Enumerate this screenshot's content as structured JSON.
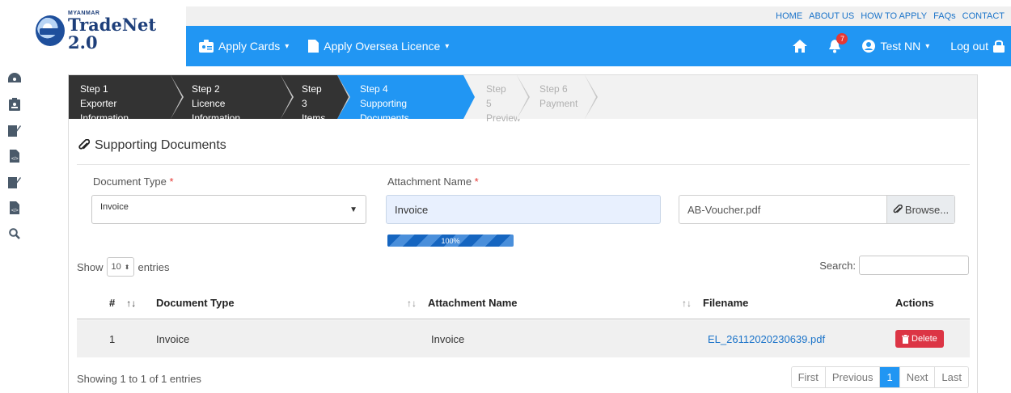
{
  "logo": {
    "small": "MYANMAR",
    "big": "TradeNet 2.0"
  },
  "toplinks": [
    "HOME",
    "ABOUT US",
    "HOW TO APPLY",
    "FAQs",
    "CONTACT"
  ],
  "nav": {
    "apply_cards": "Apply Cards",
    "apply_oversea": "Apply Oversea Licence",
    "notifications_count": "7",
    "user": "Test NN",
    "logout": "Log out"
  },
  "sidebar_icons": [
    "dashboard-icon",
    "id-card-icon",
    "signature-icon",
    "code-file-icon",
    "signature-icon",
    "code-file-icon",
    "search-icon"
  ],
  "steps": [
    {
      "num": "Step 1",
      "name": "Exporter Information",
      "state": "done"
    },
    {
      "num": "Step 2",
      "name": "Licence Information",
      "state": "done"
    },
    {
      "num": "Step 3",
      "name": "Items",
      "state": "done"
    },
    {
      "num": "Step 4",
      "name": "Supporting Documents",
      "state": "active"
    },
    {
      "num": "Step 5",
      "name": "Preview",
      "state": "pending"
    },
    {
      "num": "Step 6",
      "name": "Payment",
      "state": "pending"
    }
  ],
  "section": {
    "title": "Supporting Documents"
  },
  "form": {
    "doc_type_label": "Document Type",
    "doc_type_value": "Invoice",
    "attach_label": "Attachment Name",
    "attach_value": "Invoice",
    "file_value": "AB-Voucher.pdf",
    "browse_label": "Browse...",
    "required_mark": "*"
  },
  "progress": {
    "value": 100,
    "label": "100%"
  },
  "table_controls": {
    "show": "Show",
    "entries_value": "10",
    "entries": "entries",
    "search_label": "Search:"
  },
  "table": {
    "headers": [
      "#",
      "Document Type",
      "Attachment Name",
      "Filename",
      "Actions"
    ],
    "rows": [
      {
        "num": "1",
        "doc_type": "Invoice",
        "attach": "Invoice",
        "filename": "EL_26112020230639.pdf",
        "action": "Delete"
      }
    ]
  },
  "footer": {
    "info": "Showing 1 to 1 of 1 entries",
    "first": "First",
    "previous": "Previous",
    "page": "1",
    "next": "Next",
    "last": "Last"
  },
  "colors": {
    "primary": "#2196f3",
    "step_done": "#333333",
    "danger": "#dc3545",
    "link": "#1a73c9"
  }
}
